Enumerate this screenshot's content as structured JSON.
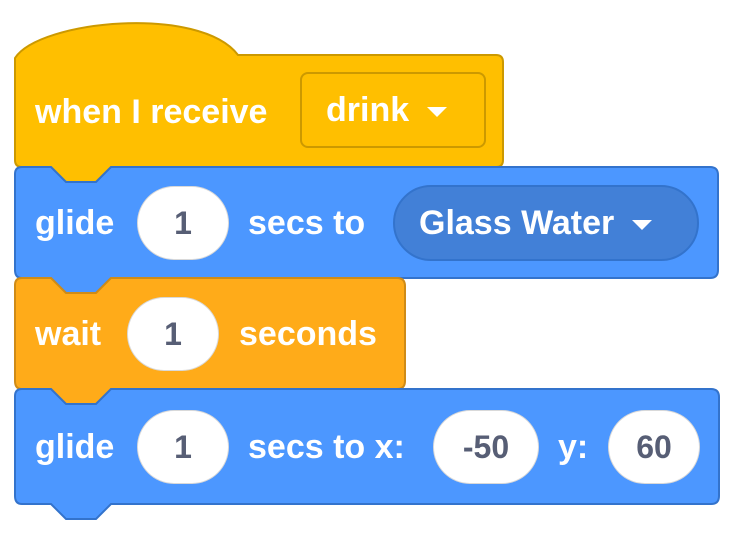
{
  "colors": {
    "events": "#FFBF00",
    "events_border": "#CC9900",
    "motion": "#4C97FF",
    "motion_border": "#3373CC",
    "motion_menu": "#4280D7",
    "control": "#FFAB19",
    "control_border": "#CF8B17",
    "input_text": "#575E75"
  },
  "blocks": [
    {
      "type": "hat",
      "label": "when I receive",
      "message_menu": {
        "value": "drink",
        "icon": "dropdown-caret-icon"
      }
    },
    {
      "type": "glide-to-target",
      "label_glide": "glide",
      "secs_value": "1",
      "label_secs_to": "secs to",
      "target_menu": {
        "value": "Glass Water",
        "icon": "dropdown-caret-icon"
      }
    },
    {
      "type": "wait",
      "label_wait": "wait",
      "seconds_value": "1",
      "label_seconds": "seconds"
    },
    {
      "type": "glide-to-xy",
      "label_glide": "glide",
      "secs_value": "1",
      "label_secs_to_x": "secs to x:",
      "x_value": "-50",
      "label_y": "y:",
      "y_value": "60"
    }
  ]
}
